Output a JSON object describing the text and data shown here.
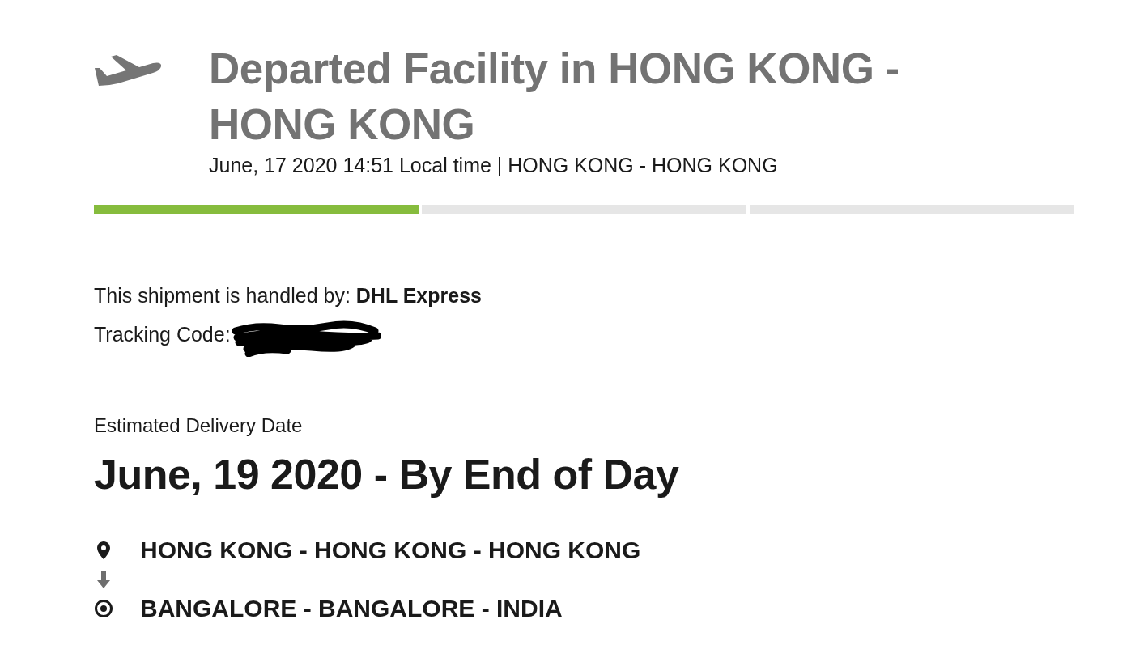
{
  "shipment_event": {
    "title": "Departed Facility in HONG KONG - HONG KONG",
    "timestamp": "June, 17 2020 14:51 Local time | HONG KONG - HONG KONG"
  },
  "progress": {
    "segments": [
      {
        "complete": true
      },
      {
        "complete": false
      },
      {
        "complete": false
      }
    ]
  },
  "handler": {
    "text": "This shipment is handled by: **DHL Express**"
  },
  "tracking_code": {
    "label": "Tracking Code:",
    "redacted": true
  },
  "estimated_delivery": {
    "label": "Estimated Delivery Date",
    "value": "June, 19 2020 - By End of Day"
  },
  "route": [
    {
      "kind": "origin",
      "place": "HONG KONG - HONG KONG - HONG KONG"
    },
    {
      "kind": "destination",
      "place": "BANGALORE - BANGALORE - INDIA"
    }
  ]
}
